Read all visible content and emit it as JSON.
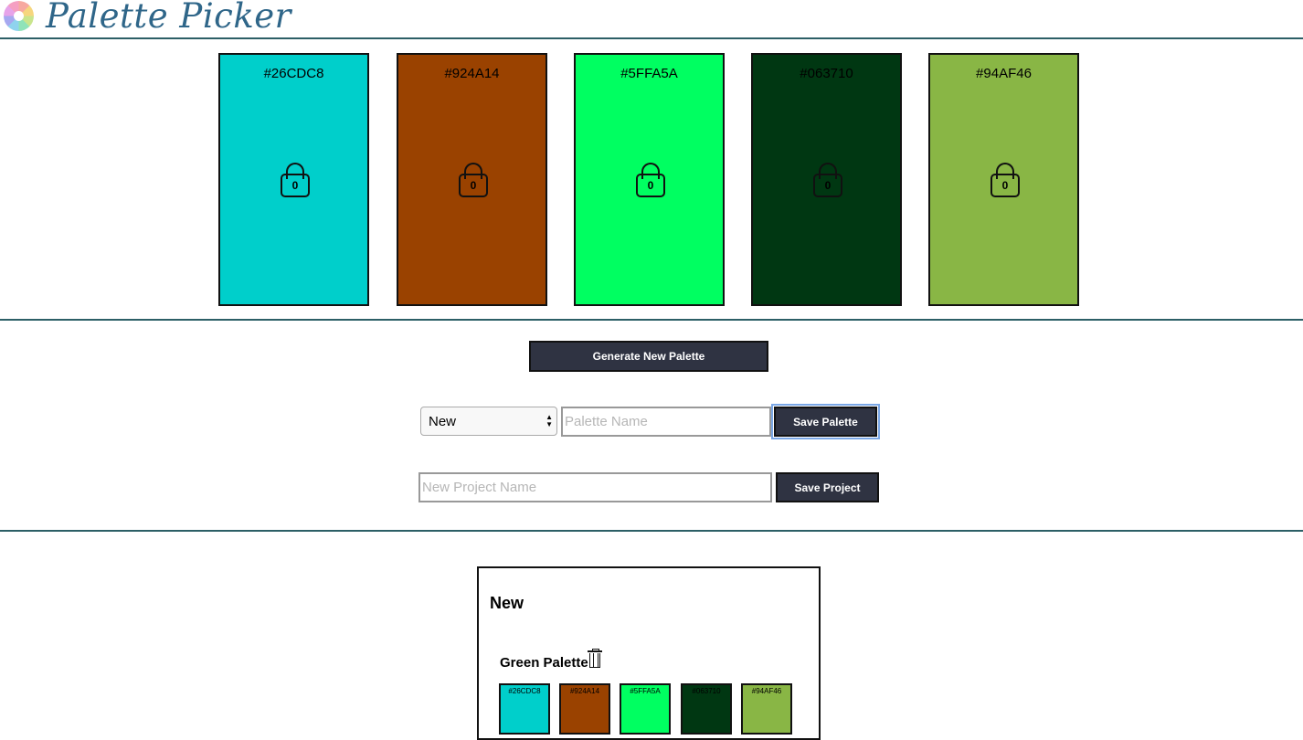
{
  "header": {
    "title": "Palette Picker",
    "logo_icon": "color-wheel-icon"
  },
  "swatches": [
    {
      "hex": "#26CDC8",
      "color": "#00CFCB",
      "lock_count": "0"
    },
    {
      "hex": "#924A14",
      "color": "#9A4200",
      "lock_count": "0"
    },
    {
      "hex": "#5FFA5A",
      "color": "#00FF61",
      "lock_count": "0"
    },
    {
      "hex": "#063710",
      "color": "#003712",
      "lock_count": "0"
    },
    {
      "hex": "#94AF46",
      "color": "#89B645",
      "lock_count": "0"
    }
  ],
  "controls": {
    "generate_label": "Generate New Palette",
    "project_select_value": "New",
    "palette_name_placeholder": "Palette Name",
    "save_palette_label": "Save Palette",
    "new_project_placeholder": "New Project Name",
    "save_project_label": "Save Project"
  },
  "projects": [
    {
      "name": "New",
      "palettes": [
        {
          "name": "Green Palette",
          "colors": [
            {
              "hex": "#26CDC8",
              "color": "#00CFCB"
            },
            {
              "hex": "#924A14",
              "color": "#9A4200"
            },
            {
              "hex": "#5FFA5A",
              "color": "#00FF61"
            },
            {
              "hex": "#063710",
              "color": "#003712"
            },
            {
              "hex": "#94AF46",
              "color": "#89B645"
            }
          ]
        }
      ]
    }
  ],
  "colors": {
    "title": "#2F6689",
    "rule": "#2C5F66",
    "button_bg": "#2F3342"
  }
}
